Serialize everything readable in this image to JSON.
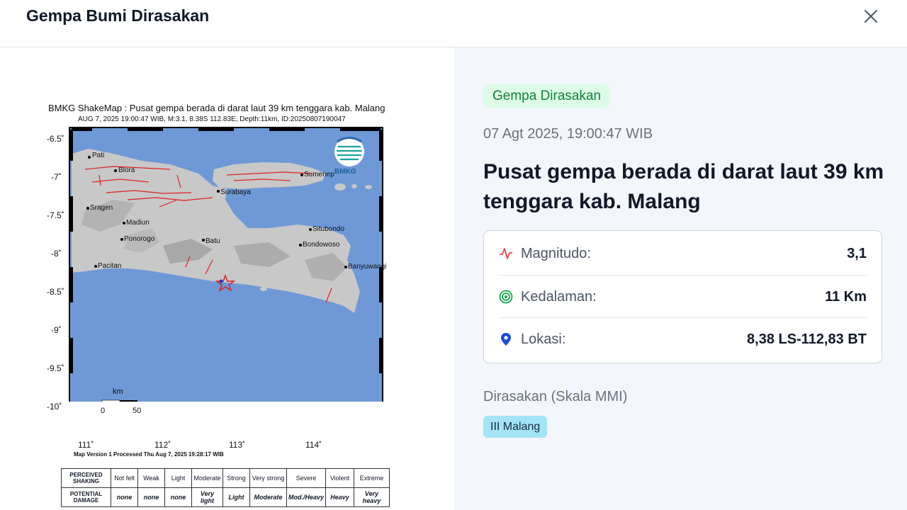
{
  "dialog": {
    "title": "Gempa Bumi Dirasakan"
  },
  "event": {
    "status": "Gempa Dirasakan",
    "datetime": "07 Agt 2025, 19:00:47 WIB",
    "headline": "Pusat gempa berada di darat laut 39 km tenggara kab. Malang",
    "details": {
      "magnitude_label": "Magnitudo:",
      "magnitude_value": "3,1",
      "depth_label": "Kedalaman:",
      "depth_value": "11 Km",
      "location_label": "Lokasi:",
      "location_value": "8,38 LS-112,83 BT"
    },
    "felt_title": "Dirasakan (Skala MMI)",
    "felt_badge": "III Malang"
  },
  "shakemap": {
    "title": "BMKG ShakeMap : Pusat gempa berada di darat laut 39 km tenggara kab. Malang",
    "subtitle": "AUG 7, 2025 19:00:47 WIB, M:3.1, 8.38S 112.83E, Depth:11km, ID:20250807190047",
    "footer": "Map Version 1 Processed Thu Aug  7, 2025 19:28:17 WIB",
    "logo_text": "BMKG",
    "scale_unit": "km",
    "scale_start": "0",
    "scale_end": "50",
    "y_ticks": [
      "-6.5˚",
      "-7˚",
      "-7.5˚",
      "-8˚",
      "-8.5˚",
      "-9˚",
      "-9.5˚",
      "-10˚"
    ],
    "x_ticks": [
      "111˚",
      "112˚",
      "113˚",
      "114˚"
    ],
    "cities": [
      "Pati",
      "Blora",
      "Sumenep",
      "Surabaya",
      "Sragen",
      "Madiun",
      "Situbondo",
      "Ponorogo",
      "Batu",
      "Bondowoso",
      "Pacitan",
      "Banyuwangi"
    ],
    "legend": {
      "row1_header": "PERCEIVED SHAKING",
      "row2_header": "POTENTIAL DAMAGE",
      "shaking": [
        "Not felt",
        "Weak",
        "Light",
        "Moderate",
        "Strong",
        "Very strong",
        "Severe",
        "Violent",
        "Extreme"
      ],
      "damage": [
        "none",
        "none",
        "none",
        "Very light",
        "Light",
        "Moderate",
        "Mod./Heavy",
        "Heavy",
        "Very heavy"
      ]
    }
  },
  "colors": {
    "sea": "#6f99d6",
    "land": "#c8c8c8",
    "badge_green_bg": "#dcfce7",
    "badge_green_text": "#15803d",
    "mmi_badge_bg": "#a5e4f7",
    "magnitude_icon": "#ef4444",
    "depth_icon": "#16a34a",
    "location_icon": "#1d4ed8"
  }
}
